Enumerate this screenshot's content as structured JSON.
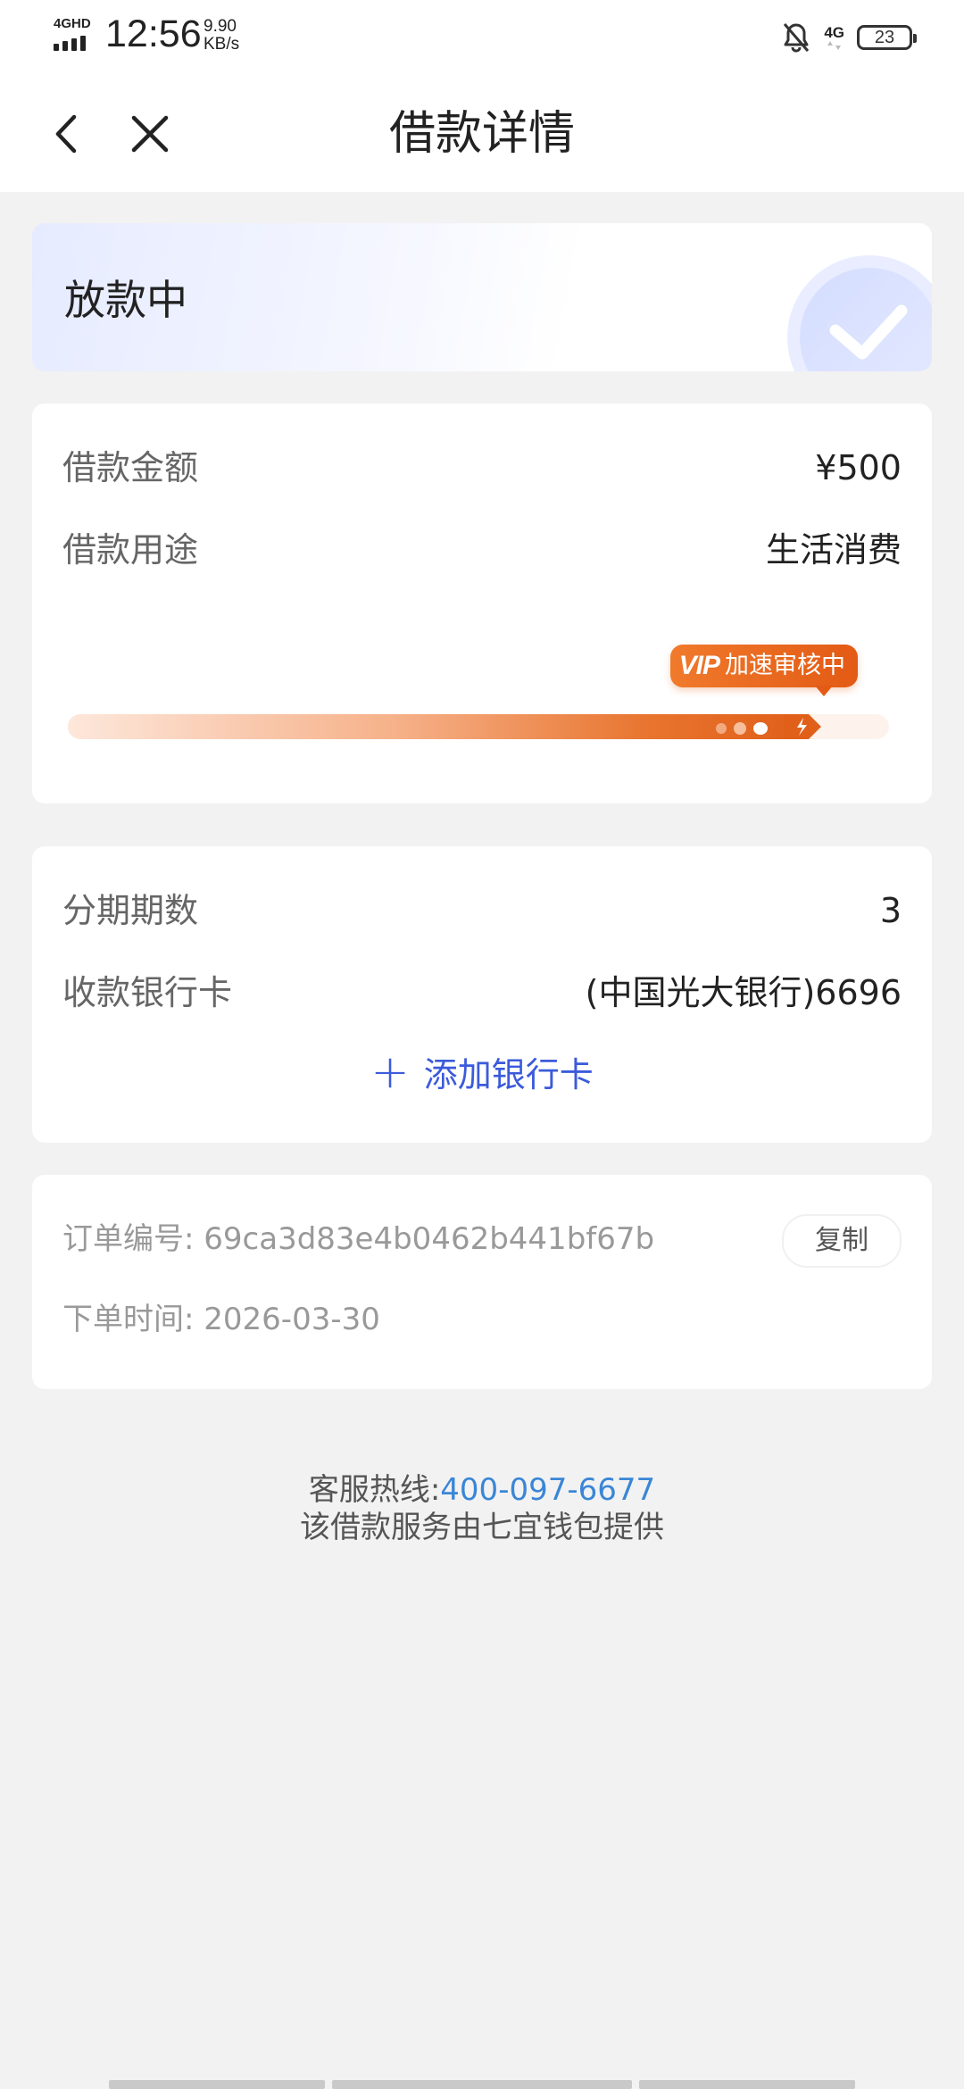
{
  "status_bar": {
    "network_left": "4GHD",
    "time": "12:56",
    "speed_value": "9.90",
    "speed_unit": "KB/s",
    "network_right": "4G",
    "battery": "23"
  },
  "nav": {
    "title": "借款详情"
  },
  "status_card": {
    "status": "放款中"
  },
  "loan": {
    "amount_label": "借款金额",
    "amount_value": "¥500",
    "purpose_label": "借款用途",
    "purpose_value": "生活消费",
    "vip_mark": "VIP",
    "vip_text": "加速审核中",
    "progress": 0.92
  },
  "bank": {
    "installments_label": "分期期数",
    "installments_value": "3",
    "card_label": "收款银行卡",
    "card_value": "(中国光大银行)6696",
    "add_card_label": "添加银行卡"
  },
  "order": {
    "number_label": "订单编号:",
    "number_value": "69ca3d83e4b0462b441bf67b",
    "copy_label": "复制",
    "time_label": "下单时间:",
    "time_value": "2026-03-30"
  },
  "footer": {
    "hotline_label": "客服热线:",
    "hotline_number": "400-097-6677",
    "provider_text": "该借款服务由七宜钱包提供"
  },
  "colors": {
    "accent_blue": "#3b5bdb",
    "hotline_blue": "#3a86d6",
    "vip_orange": "#e35a14"
  }
}
